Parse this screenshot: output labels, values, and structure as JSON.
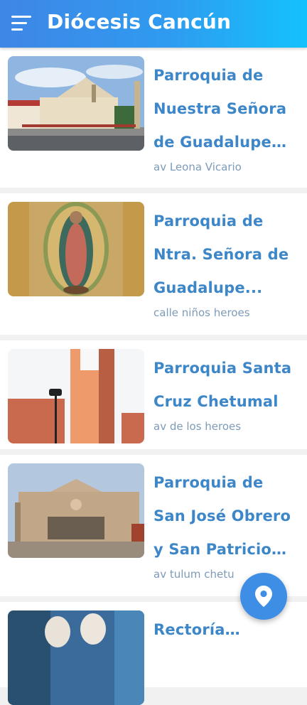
{
  "app": {
    "title": "Diócesis Cancún",
    "menu_icon": "menu-icon",
    "fab_icon": "location-pin-icon"
  },
  "colors": {
    "appbar_start": "#3f86e6",
    "appbar_end": "#14c2fb",
    "title_text": "#3d86c8",
    "address_text": "#7d9bb8",
    "fab": "#3f8ee6"
  },
  "parishes": [
    {
      "name": "Parroquia de Nuestra Señora de Guadalupe -...",
      "address": "av Leona Vicario"
    },
    {
      "name": "Parroquia de Ntra. Señora de Guadalupe...",
      "address": "calle niños heroes"
    },
    {
      "name": "Parroquia Santa Cruz Chetumal",
      "address": "av de los heroes"
    },
    {
      "name": "Parroquia de San José Obrero y San Patricio de...",
      "address": "av tulum chetu"
    },
    {
      "name": "Rectoría Sagrada",
      "address": ""
    }
  ]
}
